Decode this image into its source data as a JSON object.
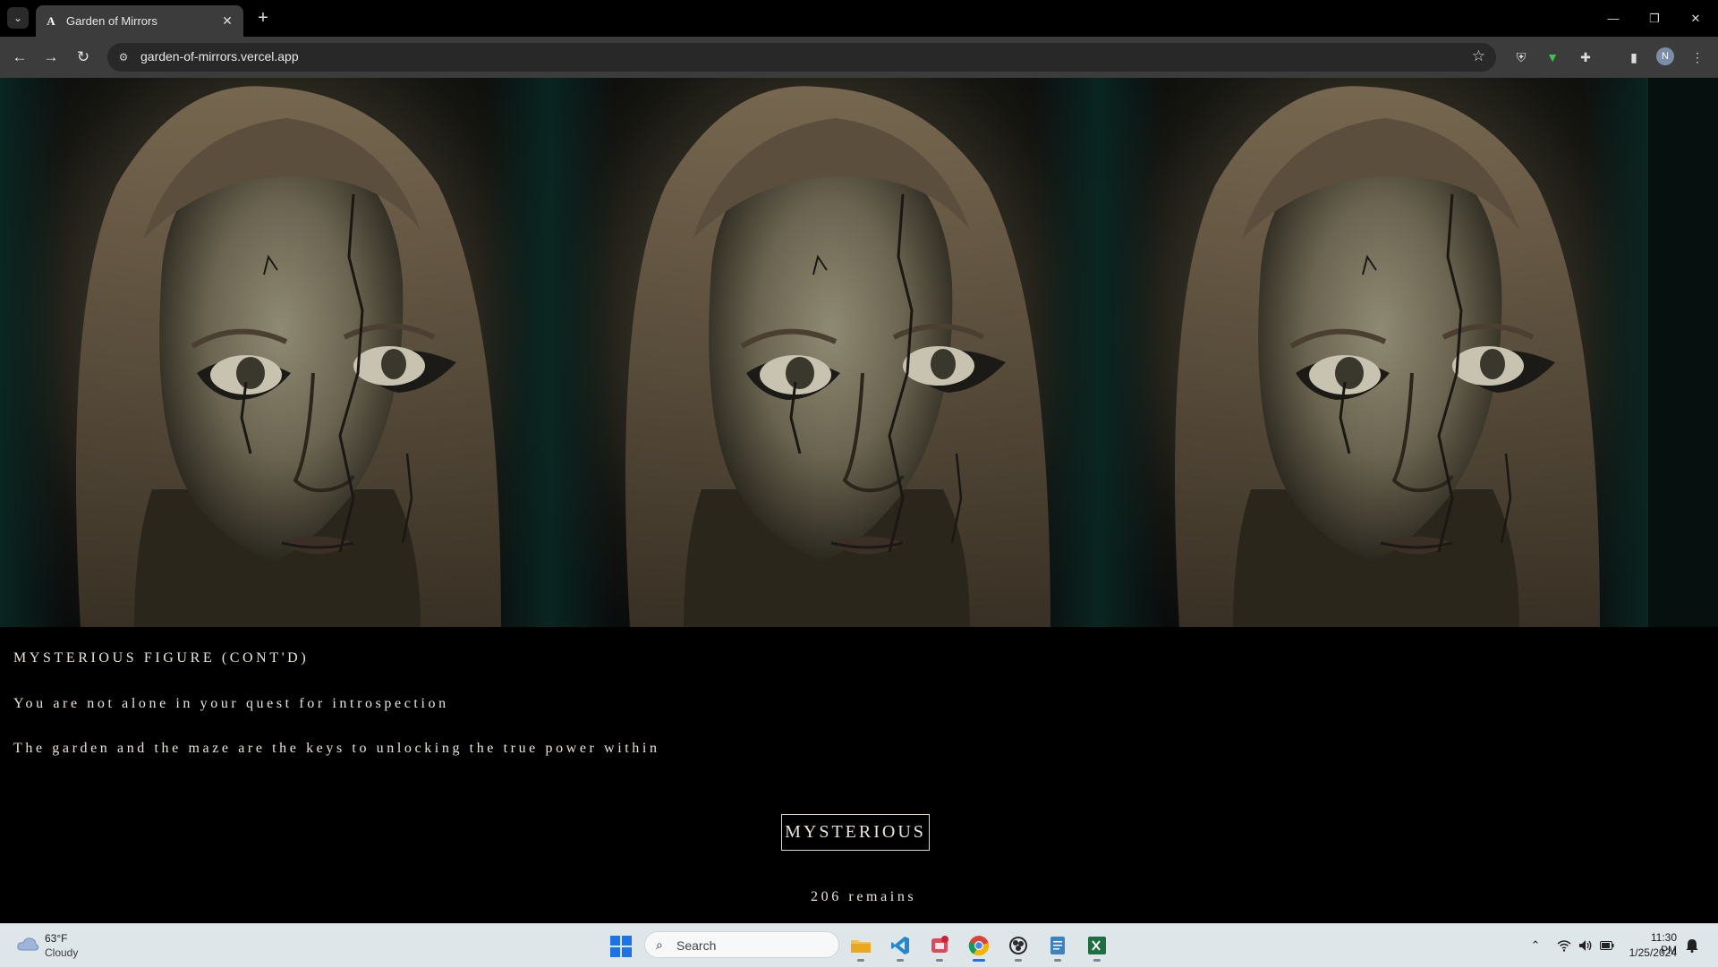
{
  "browser": {
    "tab_title": "Garden of Mirrors",
    "tab_favicon": "A",
    "url": "garden-of-mirrors.vercel.app",
    "avatar_initial": "N"
  },
  "page": {
    "panel_count": 3,
    "speaker": "MYSTERIOUS FIGURE (CONT'D)",
    "lines": [
      "You are not alone in your quest for introspection",
      "The garden and the maze are the keys to unlocking the true power within"
    ],
    "button_label": "MYSTERIOUS",
    "remains_text": "206 remains"
  },
  "taskbar": {
    "weather_temp": "63°F",
    "weather_condition": "Cloudy",
    "search_placeholder": "Search",
    "time": "11:30 PM",
    "date": "1/25/2024",
    "apps": [
      "file-explorer",
      "vscode",
      "snipping-tool",
      "chrome",
      "obs",
      "notepad",
      "excel"
    ]
  }
}
